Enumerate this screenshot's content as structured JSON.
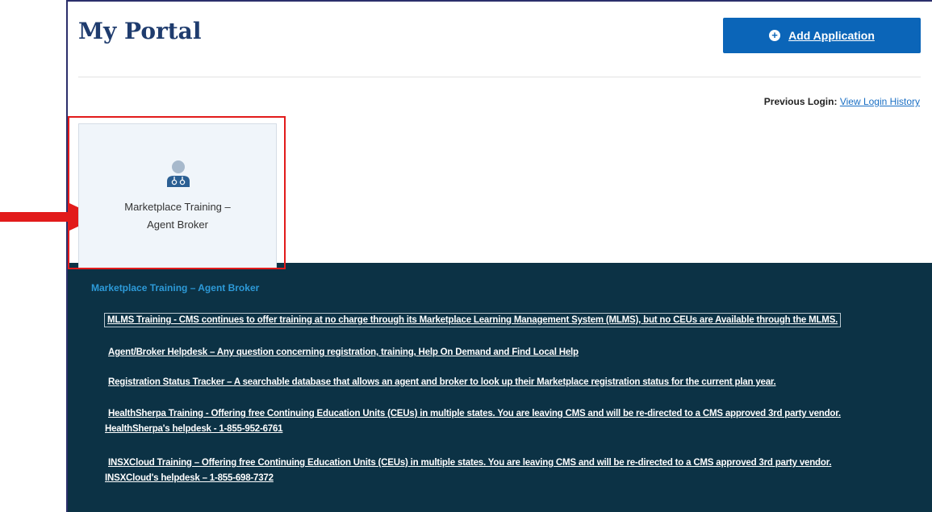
{
  "header": {
    "title": "My Portal",
    "add_button_label": "Add Application",
    "add_button_icon": "plus-circle-icon"
  },
  "login": {
    "label": "Previous Login:",
    "link": "View Login History"
  },
  "card": {
    "icon": "user-medical-icon",
    "label_line1": "Marketplace Training –",
    "label_line2": "Agent Broker"
  },
  "panel": {
    "title": "Marketplace Training – Agent Broker",
    "links": [
      {
        "text": "MLMS Training - CMS continues to offer training at no charge through its Marketplace Learning Management System (MLMS), but no CEUs are Available through the MLMS."
      },
      {
        "text": "Agent/Broker Helpdesk – Any question concerning registration, training, Help On Demand and Find Local Help"
      },
      {
        "text": "Registration Status Tracker – A searchable database that allows an agent and broker to look up their Marketplace registration status for the current plan year."
      },
      {
        "text": "HealthSherpa Training - Offering free Continuing Education Units (CEUs) in multiple states. You are leaving CMS and will be re-directed to a CMS approved 3rd party vendor.",
        "subtext": "HealthSherpa's helpdesk - 1-855-952-6761"
      },
      {
        "text": "INSXCloud Training – Offering free Continuing Education Units (CEUs) in multiple states. You are leaving CMS and will be re-directed to a CMS approved 3rd party vendor.",
        "subtext": "INSXCloud's helpdesk – 1-855-698-7372"
      }
    ]
  },
  "colors": {
    "accent": "#0b65b8",
    "panel_bg": "#0c3245",
    "panel_title": "#2d9ad8",
    "highlight": "#e21b1b"
  }
}
